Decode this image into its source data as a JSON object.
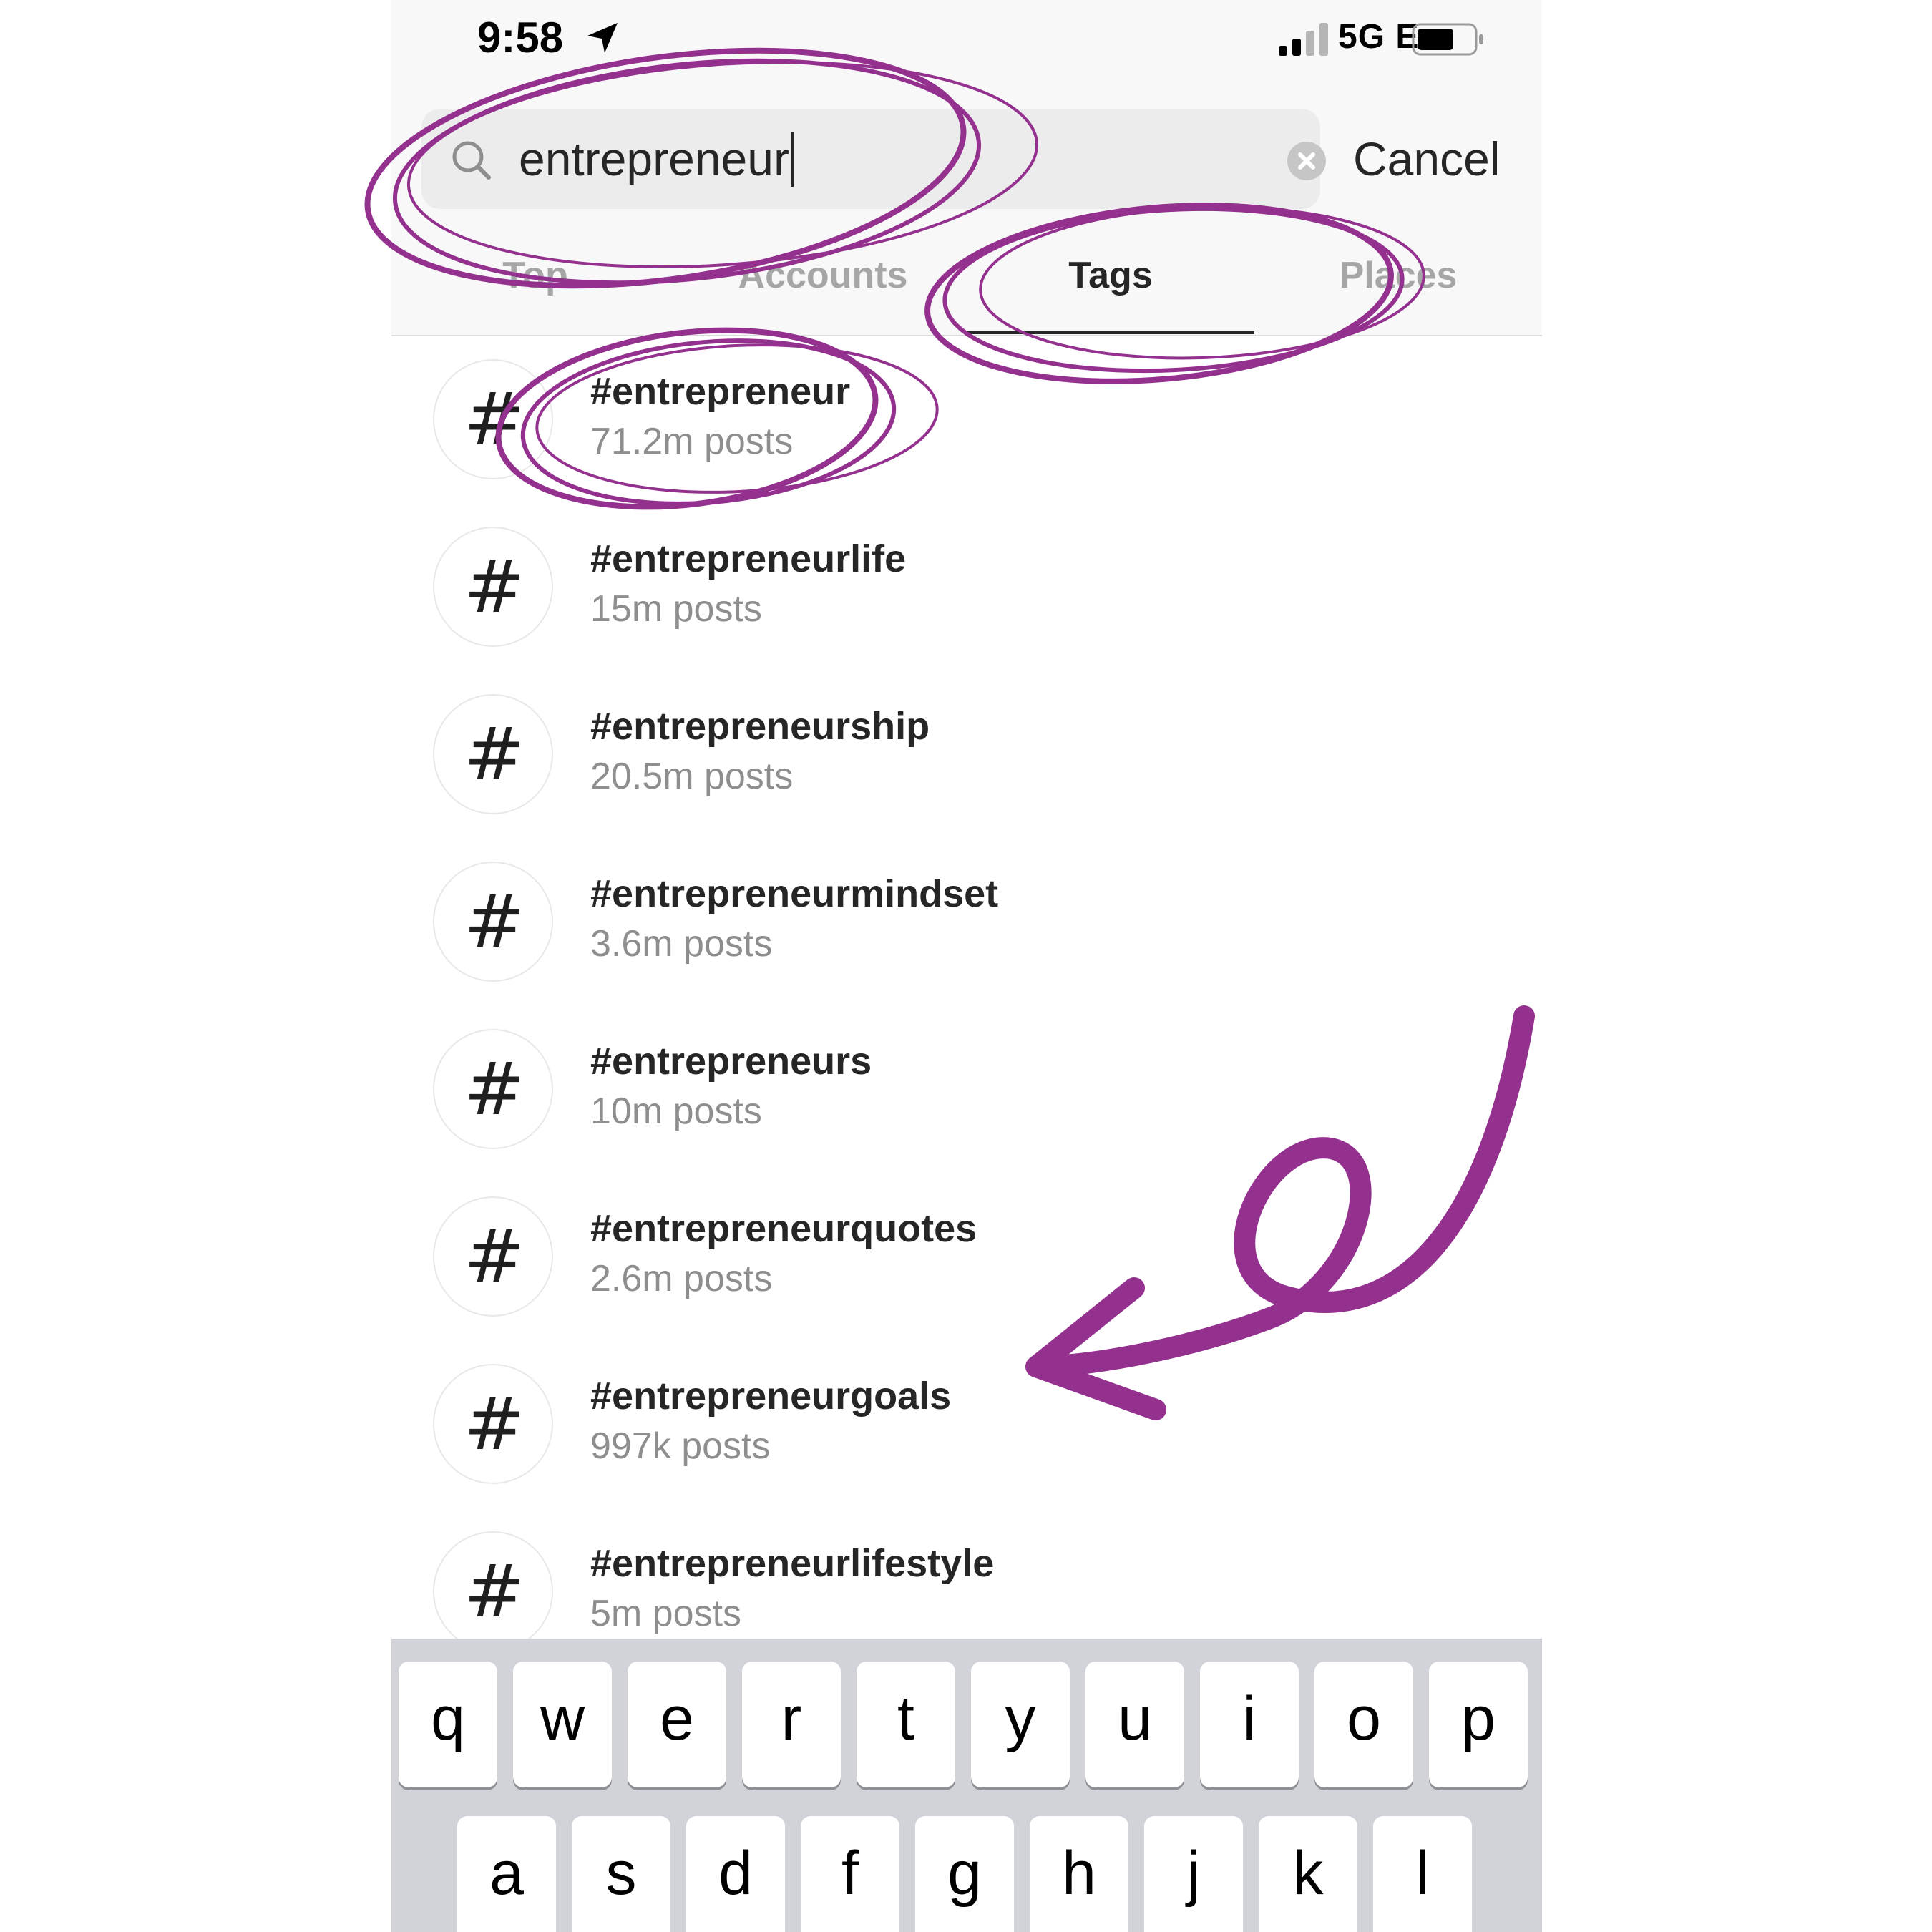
{
  "status_bar": {
    "time": "9:58",
    "network": "5G E"
  },
  "search": {
    "value": "entrepreneur",
    "cancel_label": "Cancel"
  },
  "tabs": [
    {
      "label": "Top",
      "active": false
    },
    {
      "label": "Accounts",
      "active": false
    },
    {
      "label": "Tags",
      "active": true
    },
    {
      "label": "Places",
      "active": false
    }
  ],
  "results": [
    {
      "tag": "#entrepreneur",
      "count": "71.2m posts"
    },
    {
      "tag": "#entrepreneurlife",
      "count": "15m posts"
    },
    {
      "tag": "#entrepreneurship",
      "count": "20.5m posts"
    },
    {
      "tag": "#entrepreneurmindset",
      "count": "3.6m posts"
    },
    {
      "tag": "#entrepreneurs",
      "count": "10m posts"
    },
    {
      "tag": "#entrepreneurquotes",
      "count": "2.6m posts"
    },
    {
      "tag": "#entrepreneurgoals",
      "count": "997k posts"
    },
    {
      "tag": "#entrepreneurlifestyle",
      "count": "5m posts"
    }
  ],
  "hash_symbol": "#",
  "keyboard": {
    "row1": [
      "q",
      "w",
      "e",
      "r",
      "t",
      "y",
      "u",
      "i",
      "o",
      "p"
    ],
    "row2": [
      "a",
      "s",
      "d",
      "f",
      "g",
      "h",
      "j",
      "k",
      "l"
    ]
  },
  "colors": {
    "annotation": "#94318f",
    "active_tab": "#262626",
    "inactive_tab": "#a6a6a6",
    "secondary_text": "#8e8e8e",
    "keyboard_bg": "#d1d3d9"
  },
  "icons": [
    "location-arrow-icon",
    "signal-icon",
    "battery-icon",
    "search-icon",
    "clear-icon",
    "hashtag-icon"
  ]
}
